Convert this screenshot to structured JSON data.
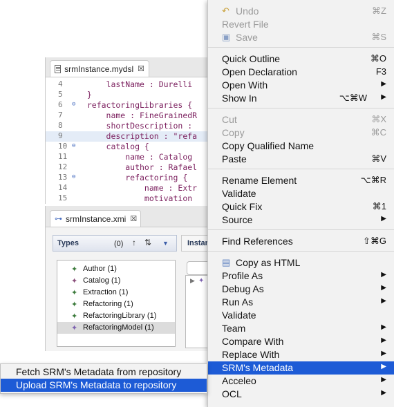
{
  "editor": {
    "tab_title": "srmInstance.mydsl",
    "tab_close": "☒",
    "lines": [
      {
        "num": "4",
        "fold": "",
        "text": "      lastName : Durelli",
        "hl": false
      },
      {
        "num": "5",
        "fold": "",
        "text": "  }",
        "hl": false
      },
      {
        "num": "6",
        "fold": "⊖",
        "text": "  refactoringLibraries {",
        "hl": false
      },
      {
        "num": "7",
        "fold": "",
        "text": "      name : FineGrainedR",
        "hl": false
      },
      {
        "num": "8",
        "fold": "",
        "text": "      shortDescription :",
        "hl": false
      },
      {
        "num": "9",
        "fold": "",
        "text": "      description : \"refa",
        "hl": true
      },
      {
        "num": "10",
        "fold": "⊖",
        "text": "      catalog {",
        "hl": false
      },
      {
        "num": "11",
        "fold": "",
        "text": "          name : Catalog",
        "hl": false
      },
      {
        "num": "12",
        "fold": "",
        "text": "          author : Rafael",
        "hl": false
      },
      {
        "num": "13",
        "fold": "⊖",
        "text": "          refactoring {",
        "hl": false
      },
      {
        "num": "14",
        "fold": "",
        "text": "              name : Extr",
        "hl": false
      },
      {
        "num": "15",
        "fold": "",
        "text": "              motivation",
        "hl": false
      }
    ]
  },
  "xmi": {
    "tab_title": "srmInstance.xmi",
    "tab_close": "☒",
    "types_label": "Types",
    "types_count": "(0)",
    "instances_label": "Instan",
    "types": [
      {
        "label": "Author (1)",
        "selected": false
      },
      {
        "label": "Catalog (1)",
        "selected": false
      },
      {
        "label": "Extraction (1)",
        "selected": false
      },
      {
        "label": "Refactoring (1)",
        "selected": false
      },
      {
        "label": "RefactoringLibrary (1)",
        "selected": false
      },
      {
        "label": "RefactoringModel (1)",
        "selected": true
      }
    ]
  },
  "menu": {
    "items": [
      {
        "label": "Undo",
        "shortcut": "⌘Z",
        "disabled": true,
        "submenu": false,
        "icon": "undo-icon"
      },
      {
        "label": "Revert File",
        "shortcut": "",
        "disabled": true,
        "submenu": false
      },
      {
        "label": "Save",
        "shortcut": "⌘S",
        "disabled": true,
        "submenu": false,
        "icon": "save-icon"
      },
      {
        "sep": true
      },
      {
        "label": "Quick Outline",
        "shortcut": "⌘O",
        "disabled": false,
        "submenu": false
      },
      {
        "label": "Open Declaration",
        "shortcut": "F3",
        "disabled": false,
        "submenu": false
      },
      {
        "label": "Open With",
        "shortcut": "",
        "disabled": false,
        "submenu": true
      },
      {
        "label": "Show In",
        "shortcut": "⌥⌘W",
        "disabled": false,
        "submenu": true
      },
      {
        "sep": true
      },
      {
        "label": "Cut",
        "shortcut": "⌘X",
        "disabled": true,
        "submenu": false
      },
      {
        "label": "Copy",
        "shortcut": "⌘C",
        "disabled": true,
        "submenu": false
      },
      {
        "label": "Copy Qualified Name",
        "shortcut": "",
        "disabled": false,
        "submenu": false
      },
      {
        "label": "Paste",
        "shortcut": "⌘V",
        "disabled": false,
        "submenu": false
      },
      {
        "sep": true
      },
      {
        "label": "Rename Element",
        "shortcut": "⌥⌘R",
        "disabled": false,
        "submenu": false
      },
      {
        "label": "Validate",
        "shortcut": "",
        "disabled": false,
        "submenu": false
      },
      {
        "label": "Quick Fix",
        "shortcut": "⌘1",
        "disabled": false,
        "submenu": false
      },
      {
        "label": "Source",
        "shortcut": "",
        "disabled": false,
        "submenu": true
      },
      {
        "sep": true
      },
      {
        "label": "Find References",
        "shortcut": "⇧⌘G",
        "disabled": false,
        "submenu": false
      },
      {
        "sep": true
      },
      {
        "label": "Copy as HTML",
        "shortcut": "",
        "disabled": false,
        "submenu": false,
        "icon": "copy-html-icon"
      },
      {
        "label": "Profile As",
        "shortcut": "",
        "disabled": false,
        "submenu": true
      },
      {
        "label": "Debug As",
        "shortcut": "",
        "disabled": false,
        "submenu": true
      },
      {
        "label": "Run As",
        "shortcut": "",
        "disabled": false,
        "submenu": true
      },
      {
        "label": "Validate",
        "shortcut": "",
        "disabled": false,
        "submenu": false
      },
      {
        "label": "Team",
        "shortcut": "",
        "disabled": false,
        "submenu": true
      },
      {
        "label": "Compare With",
        "shortcut": "",
        "disabled": false,
        "submenu": true
      },
      {
        "label": "Replace With",
        "shortcut": "",
        "disabled": false,
        "submenu": true
      },
      {
        "label": "SRM's Metadata",
        "shortcut": "",
        "disabled": false,
        "submenu": true,
        "highlighted": true
      },
      {
        "label": "Acceleo",
        "shortcut": "",
        "disabled": false,
        "submenu": true
      },
      {
        "label": "OCL",
        "shortcut": "",
        "disabled": false,
        "submenu": true
      }
    ]
  },
  "submenu": {
    "items": [
      {
        "label": "Fetch SRM's Metadata from repository",
        "highlighted": false
      },
      {
        "label": "Upload SRM's Metadata to repository",
        "highlighted": true
      }
    ]
  },
  "colors": {
    "highlight": "#1d5bd6",
    "disabled_text": "#9a9a9a",
    "menu_bg": "#f2f2f2"
  }
}
